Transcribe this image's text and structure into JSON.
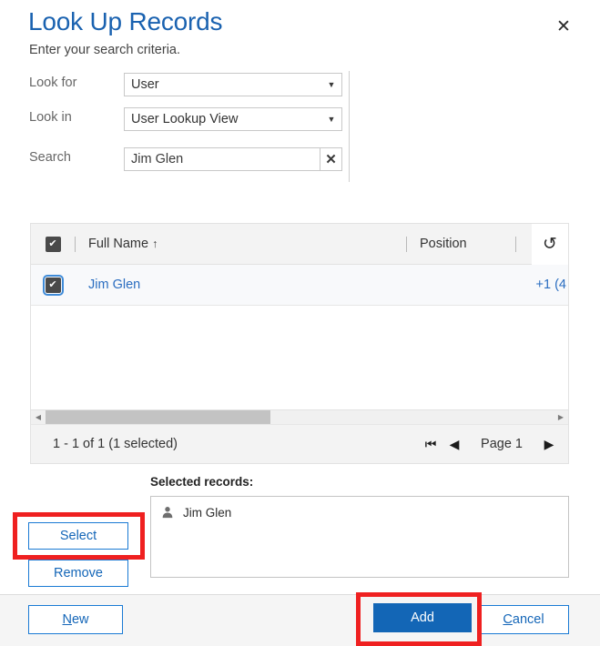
{
  "header": {
    "title": "Look Up Records",
    "subtitle": "Enter your search criteria.",
    "close_icon": "close-icon",
    "close_glyph": "✕"
  },
  "form": {
    "look_for": {
      "label": "Look for",
      "value": "User",
      "caret_glyph": "▼"
    },
    "look_in": {
      "label": "Look in",
      "value": "User Lookup View",
      "caret_glyph": "▼"
    },
    "search": {
      "label": "Search",
      "value": "Jim Glen",
      "placeholder": "",
      "clear_glyph": "✕",
      "clear_icon": "clear-search-icon"
    }
  },
  "grid": {
    "select_all_checked": true,
    "check_glyph": "✔",
    "columns": [
      {
        "label": "Full Name",
        "sorted": true,
        "sort_glyph": "↑"
      },
      {
        "label": "Position",
        "sorted": false,
        "sort_glyph": ""
      },
      {
        "label": "",
        "sorted": false,
        "sort_glyph": ""
      }
    ],
    "refresh_icon": "refresh-icon",
    "refresh_glyph": "↻",
    "rows": [
      {
        "checked": true,
        "full_name": "Jim Glen",
        "position": "",
        "partial": "+1 (4"
      }
    ],
    "hscroll": {
      "left_glyph": "◀",
      "right_glyph": "▶"
    },
    "pager": {
      "count_text": "1 - 1 of 1 (1 selected)",
      "page_label": "Page 1",
      "first_glyph": "⏮",
      "prev_glyph": "◀",
      "next_glyph": "▶"
    }
  },
  "selected_records": {
    "label": "Selected records:",
    "items": [
      {
        "name": "Jim Glen",
        "icon": "person-icon"
      }
    ]
  },
  "side_buttons": {
    "select_label": "Select",
    "remove_label": "Remove"
  },
  "footer": {
    "new": {
      "accesskey": "N",
      "rest": "ew"
    },
    "add_label": "Add",
    "cancel": {
      "accesskey": "C",
      "rest": "ancel"
    }
  },
  "annotations": {
    "highlight_color": "#ef2020",
    "boxes": [
      "select-button",
      "add-button"
    ]
  },
  "colors": {
    "title_blue": "#1a62b0",
    "link_blue": "#2a6dc0",
    "button_blue": "#1366b6",
    "border_blue": "#1a7ad4",
    "highlight_red": "#ef2020"
  }
}
